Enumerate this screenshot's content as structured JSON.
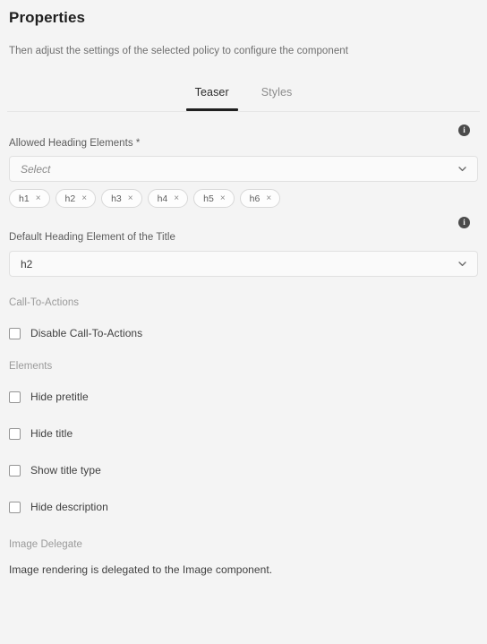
{
  "header": {
    "title": "Properties",
    "subtitle": "Then adjust the settings of the selected policy to configure the component"
  },
  "tabs": [
    {
      "label": "Teaser",
      "active": true
    },
    {
      "label": "Styles",
      "active": false
    }
  ],
  "fields": {
    "allowed_heading": {
      "label": "Allowed Heading Elements *",
      "placeholder": "Select",
      "info_glyph": "i",
      "chips": [
        {
          "label": "h1",
          "remove": "×"
        },
        {
          "label": "h2",
          "remove": "×"
        },
        {
          "label": "h3",
          "remove": "×"
        },
        {
          "label": "h4",
          "remove": "×"
        },
        {
          "label": "h5",
          "remove": "×"
        },
        {
          "label": "h6",
          "remove": "×"
        }
      ]
    },
    "default_heading": {
      "label": "Default Heading Element of the Title",
      "value": "h2",
      "info_glyph": "i"
    }
  },
  "sections": {
    "call_to_actions": {
      "label": "Call-To-Actions",
      "checkboxes": [
        {
          "label": "Disable Call-To-Actions",
          "checked": false
        }
      ]
    },
    "elements": {
      "label": "Elements",
      "checkboxes": [
        {
          "label": "Hide pretitle",
          "checked": false
        },
        {
          "label": "Hide title",
          "checked": false
        },
        {
          "label": "Show title type",
          "checked": false
        },
        {
          "label": "Hide description",
          "checked": false
        }
      ]
    },
    "image_delegate": {
      "label": "Image Delegate",
      "text": "Image rendering is delegated to the Image component."
    }
  },
  "colors": {
    "background": "#f4f4f4",
    "accent": "#1f1f1f",
    "border": "#e0e0e0"
  }
}
